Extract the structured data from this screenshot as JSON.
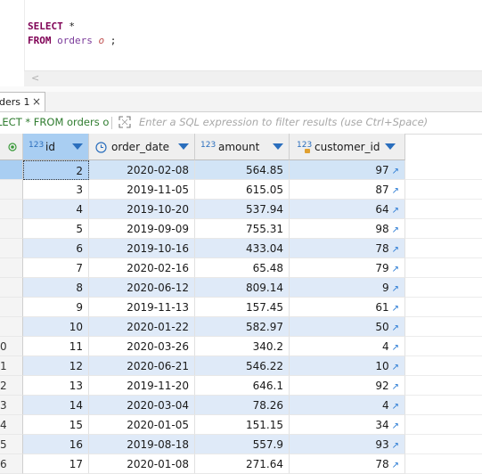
{
  "editor": {
    "line1": {
      "kw": "SELECT",
      "rest": " *"
    },
    "line2": {
      "kw": "FROM",
      "table": " orders",
      "alias": " o",
      "end": " ;"
    },
    "scroll_arrow": "<"
  },
  "result_tab": {
    "label": "ders 1",
    "close": "×"
  },
  "filter": {
    "query": "LECT * FROM orders o",
    "placeholder": "Enter a SQL expression to filter results (use Ctrl+Space)"
  },
  "columns": [
    {
      "label": "id",
      "icon": "123",
      "icon_name": "number-icon"
    },
    {
      "label": "order_date",
      "icon": "◷",
      "icon_name": "clock-icon"
    },
    {
      "label": "amount",
      "icon": "123",
      "icon_name": "number-icon"
    },
    {
      "label": "customer_id",
      "icon": "123",
      "icon_name": "foreign-key-number-icon"
    }
  ],
  "rows": [
    {
      "rownum": "",
      "id": "2",
      "order_date": "2020-02-08",
      "amount": "564.85",
      "customer_id": "97"
    },
    {
      "rownum": "",
      "id": "3",
      "order_date": "2019-11-05",
      "amount": "615.05",
      "customer_id": "87"
    },
    {
      "rownum": "",
      "id": "4",
      "order_date": "2019-10-20",
      "amount": "537.94",
      "customer_id": "64"
    },
    {
      "rownum": "",
      "id": "5",
      "order_date": "2019-09-09",
      "amount": "755.31",
      "customer_id": "98"
    },
    {
      "rownum": "",
      "id": "6",
      "order_date": "2019-10-16",
      "amount": "433.04",
      "customer_id": "78"
    },
    {
      "rownum": "",
      "id": "7",
      "order_date": "2020-02-16",
      "amount": "65.48",
      "customer_id": "79"
    },
    {
      "rownum": "",
      "id": "8",
      "order_date": "2020-06-12",
      "amount": "809.14",
      "customer_id": "9"
    },
    {
      "rownum": "",
      "id": "9",
      "order_date": "2019-11-13",
      "amount": "157.45",
      "customer_id": "61"
    },
    {
      "rownum": "",
      "id": "10",
      "order_date": "2020-01-22",
      "amount": "582.97",
      "customer_id": "50"
    },
    {
      "rownum": "0",
      "id": "11",
      "order_date": "2020-03-26",
      "amount": "340.2",
      "customer_id": "4"
    },
    {
      "rownum": "1",
      "id": "12",
      "order_date": "2020-06-21",
      "amount": "546.22",
      "customer_id": "10"
    },
    {
      "rownum": "2",
      "id": "13",
      "order_date": "2019-11-20",
      "amount": "646.1",
      "customer_id": "92"
    },
    {
      "rownum": "3",
      "id": "14",
      "order_date": "2020-03-04",
      "amount": "78.26",
      "customer_id": "4"
    },
    {
      "rownum": "4",
      "id": "15",
      "order_date": "2020-01-05",
      "amount": "151.15",
      "customer_id": "34"
    },
    {
      "rownum": "5",
      "id": "16",
      "order_date": "2019-08-18",
      "amount": "557.9",
      "customer_id": "93"
    },
    {
      "rownum": "6",
      "id": "17",
      "order_date": "2020-01-08",
      "amount": "271.64",
      "customer_id": "78"
    }
  ],
  "colors": {
    "header_selected": "#a9cef2",
    "row_alt": "#dfeaf8",
    "link_icon": "#2a7bd4",
    "filter_query": "#2f7c2f"
  }
}
